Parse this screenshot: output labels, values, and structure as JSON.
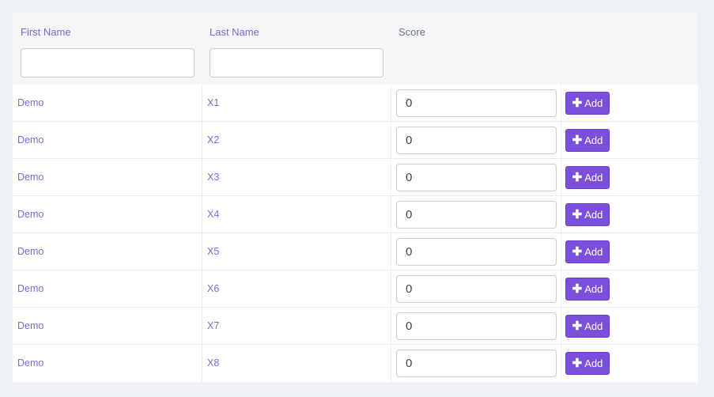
{
  "table": {
    "headers": {
      "first_name": "First Name",
      "last_name": "Last Name",
      "score": "Score"
    },
    "filters": {
      "first_name_value": "",
      "last_name_value": ""
    },
    "add_label": "Add",
    "add_icon": "plus-icon",
    "rows": [
      {
        "first": "Demo",
        "last": "X1",
        "score": "0"
      },
      {
        "first": "Demo",
        "last": "X2",
        "score": "0"
      },
      {
        "first": "Demo",
        "last": "X3",
        "score": "0"
      },
      {
        "first": "Demo",
        "last": "X4",
        "score": "0"
      },
      {
        "first": "Demo",
        "last": "X5",
        "score": "0"
      },
      {
        "first": "Demo",
        "last": "X6",
        "score": "0"
      },
      {
        "first": "Demo",
        "last": "X7",
        "score": "0"
      },
      {
        "first": "Demo",
        "last": "X8",
        "score": "0"
      }
    ]
  },
  "colors": {
    "accent": "#7a4fdc",
    "label": "#7f67d6",
    "background": "#eef1f5"
  }
}
